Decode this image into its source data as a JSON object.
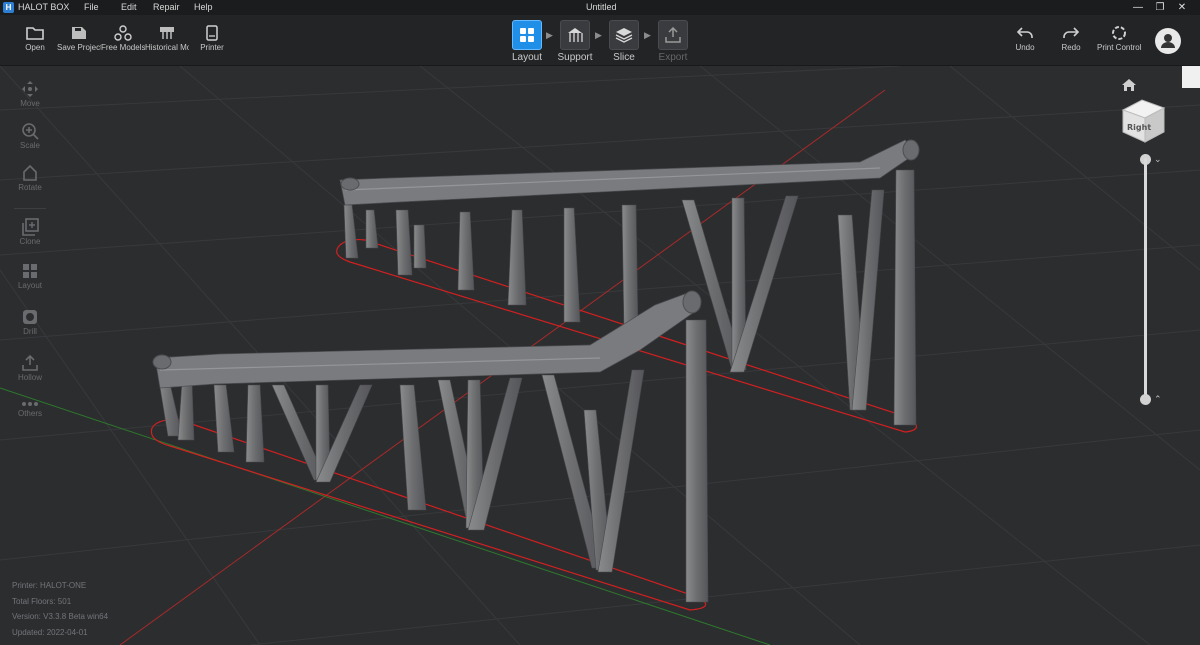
{
  "titlebar": {
    "app_name": "HALOT BOX",
    "logo_letter": "H",
    "menu": [
      "File",
      "Edit",
      "Repair",
      "Help"
    ],
    "document": "Untitled",
    "buttons": {
      "minimize": "—",
      "restore": "❐",
      "close": "✕"
    }
  },
  "toolbar": {
    "left": [
      {
        "label": "Open",
        "icon": "folder-icon"
      },
      {
        "label": "Save Project",
        "icon": "save-project-icon"
      },
      {
        "label": "Free Models",
        "icon": "free-models-icon"
      },
      {
        "label": "Historical Models",
        "icon": "historical-models-icon"
      },
      {
        "label": "Printer",
        "icon": "printer-icon"
      }
    ],
    "steps": [
      {
        "label": "Layout",
        "icon": "layout-icon",
        "state": "active"
      },
      {
        "label": "Support",
        "icon": "support-icon",
        "state": "normal"
      },
      {
        "label": "Slice",
        "icon": "slice-icon",
        "state": "normal"
      },
      {
        "label": "Export",
        "icon": "export-icon",
        "state": "disabled"
      }
    ],
    "right": [
      {
        "label": "Undo",
        "icon": "undo-icon"
      },
      {
        "label": "Redo",
        "icon": "redo-icon"
      },
      {
        "label": "Print Control",
        "icon": "print-control-icon"
      }
    ]
  },
  "left_tools": [
    {
      "label": "Move",
      "icon": "move-icon"
    },
    {
      "label": "Scale",
      "icon": "scale-icon"
    },
    {
      "label": "Rotate",
      "icon": "rotate-icon"
    },
    {
      "label": "Clone",
      "icon": "clone-icon"
    },
    {
      "label": "Layout",
      "icon": "auto-layout-icon"
    },
    {
      "label": "Drill",
      "icon": "drill-icon"
    },
    {
      "label": "Hollow",
      "icon": "hollow-icon"
    },
    {
      "label": "Others",
      "icon": "others-icon"
    }
  ],
  "info": {
    "printer": "Printer: HALOT-ONE",
    "floors": "Total Floors: 501",
    "version": "Version: V3.3.8 Beta win64",
    "updated": "Updated:  2022-04-01"
  },
  "view_cube": {
    "face_label": "Right"
  },
  "colors": {
    "accent": "#1f8fe8",
    "titlebar_bg": "#1b1c1e",
    "toolbar_bg": "#232426",
    "viewport_bg": "#2c2d2f",
    "grid_line": "#3a3b3d",
    "axis_red": "#b02a2a",
    "axis_green": "#2f7a2f",
    "model_gray": "#737476",
    "outline_red": "#d22020"
  }
}
